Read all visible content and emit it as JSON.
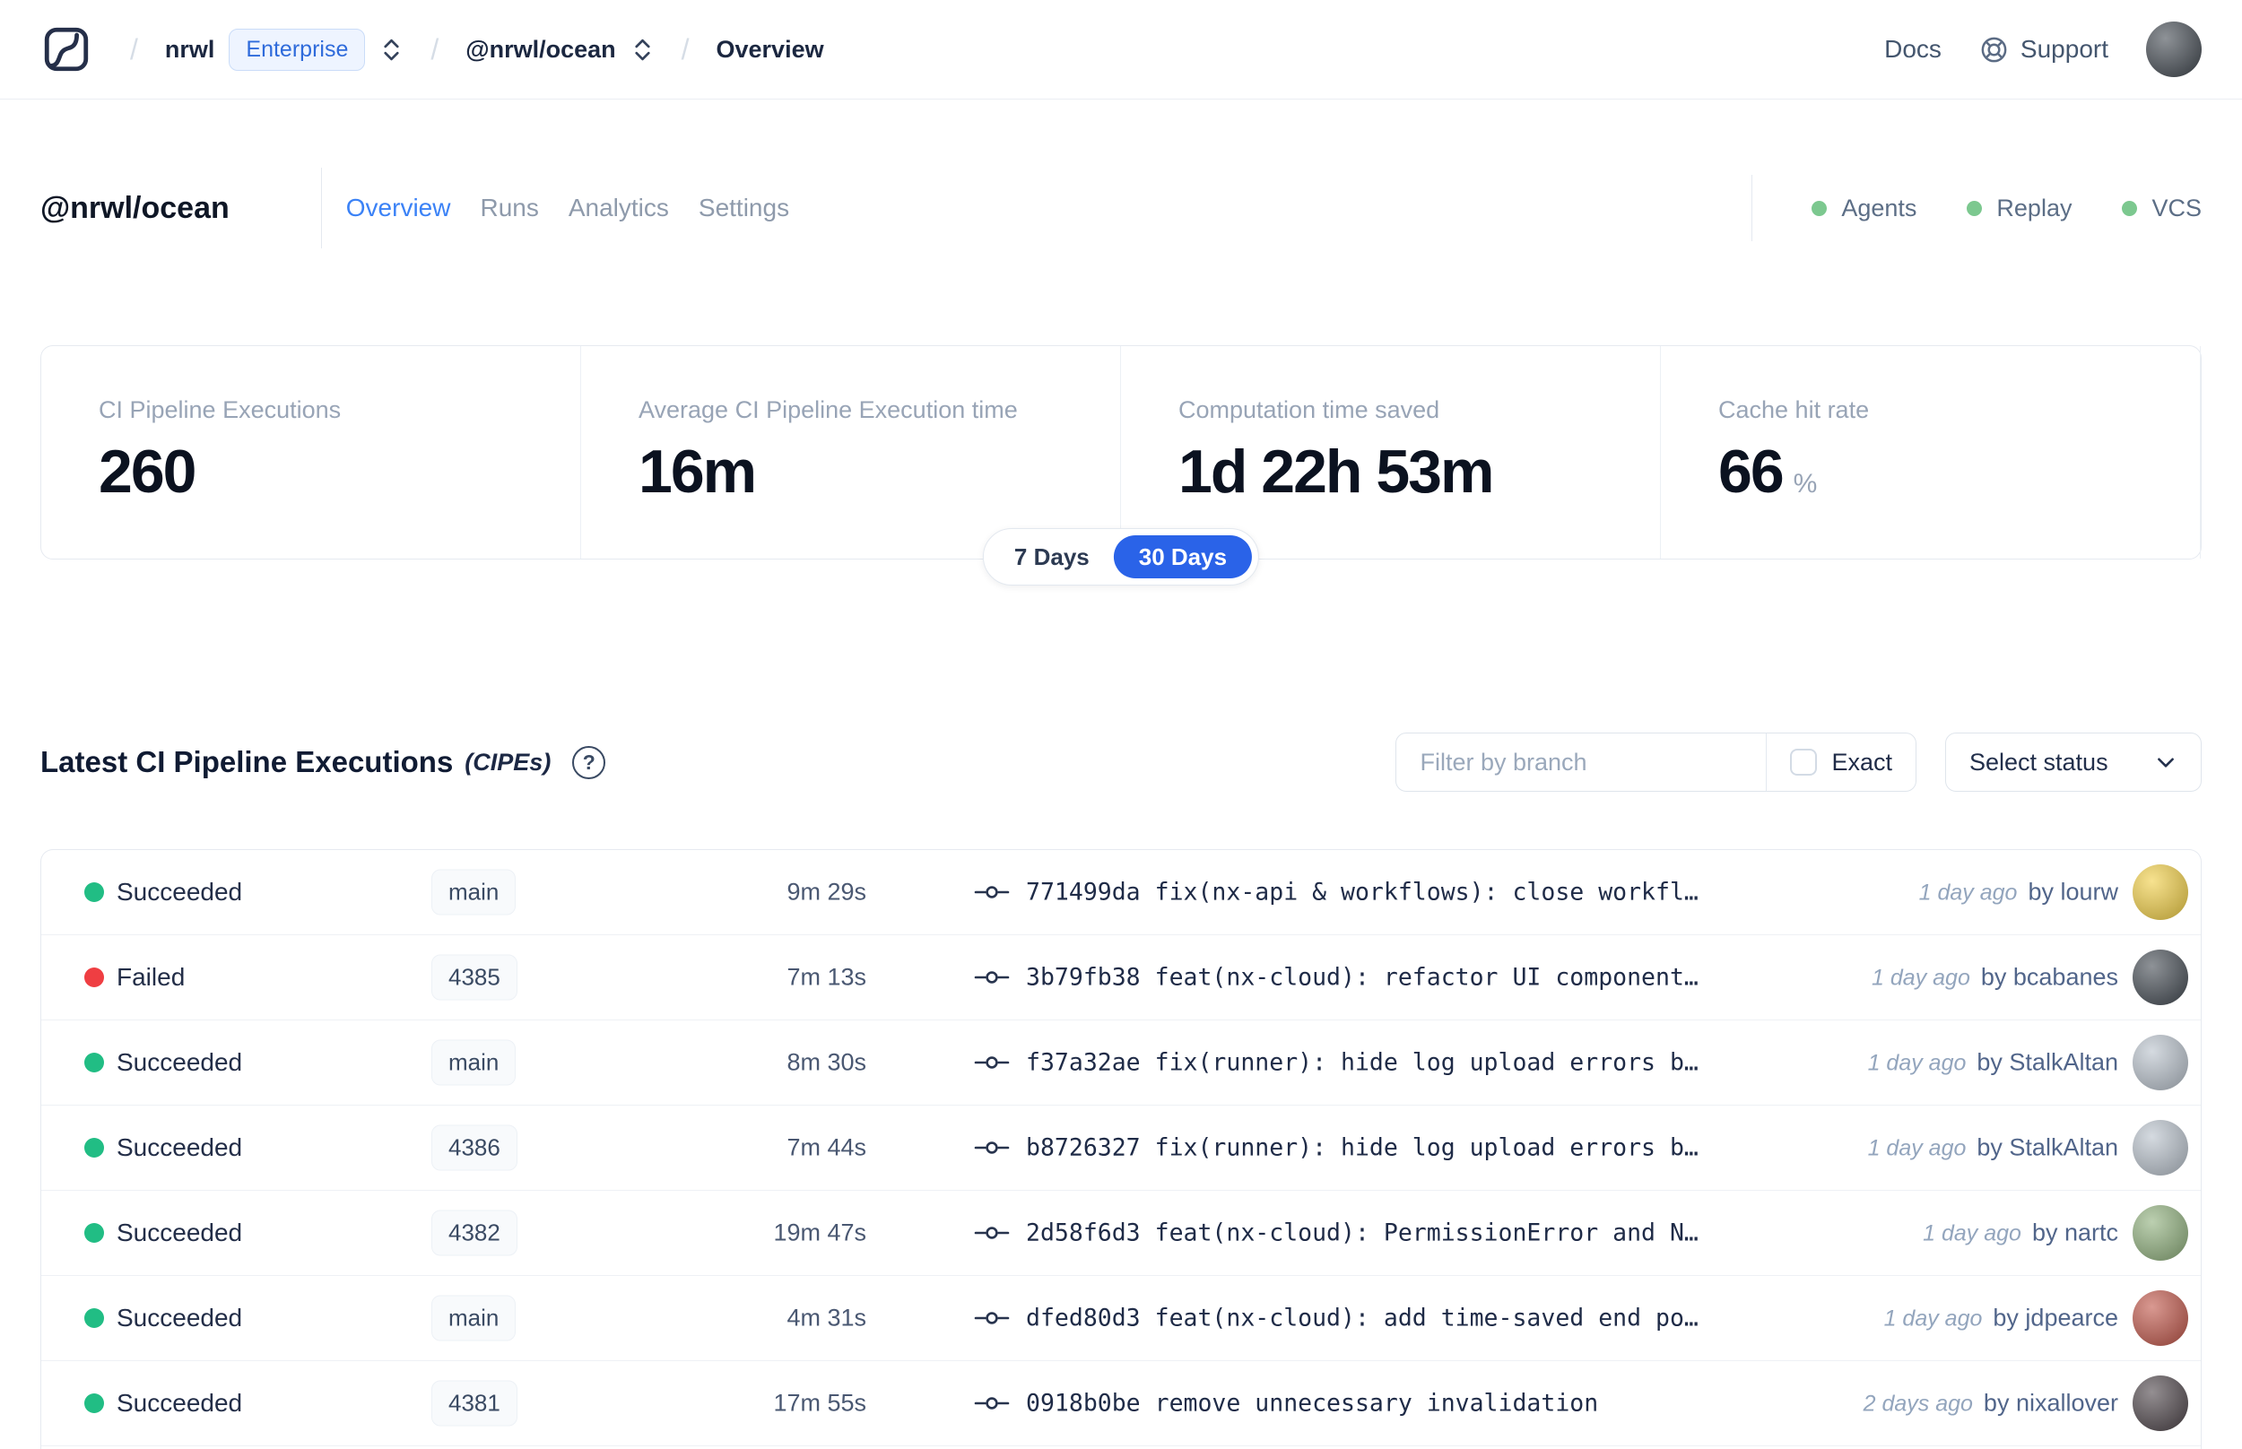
{
  "colors": {
    "success": "#21bd84",
    "failed": "#ef3e42",
    "feature_dot": "#7cc88f",
    "accent": "#2a63e8"
  },
  "nav": {
    "separator": "/",
    "org": "nrwl",
    "org_badge": "Enterprise",
    "workspace": "@nrwl/ocean",
    "page": "Overview",
    "docs": "Docs",
    "support": "Support"
  },
  "header": {
    "workspace": "@nrwl/ocean",
    "tabs": [
      {
        "label": "Overview"
      },
      {
        "label": "Runs"
      },
      {
        "label": "Analytics"
      },
      {
        "label": "Settings"
      }
    ],
    "features": [
      {
        "label": "Agents"
      },
      {
        "label": "Replay"
      },
      {
        "label": "VCS"
      }
    ]
  },
  "stats": {
    "cards": [
      {
        "label": "CI Pipeline Executions",
        "value": "260",
        "unit": ""
      },
      {
        "label": "Average CI Pipeline Execution time",
        "value": "16m",
        "unit": ""
      },
      {
        "label": "Computation time saved",
        "value": "1d 22h 53m",
        "unit": ""
      },
      {
        "label": "Cache hit rate",
        "value": "66",
        "unit": "%"
      }
    ],
    "range": {
      "options": [
        {
          "label": "7 Days"
        },
        {
          "label": "30 Days"
        }
      ],
      "selected": "30 Days"
    }
  },
  "section": {
    "title": "Latest CI Pipeline Executions",
    "subtitle": "(CIPEs)",
    "help_glyph": "?"
  },
  "filters": {
    "branch_placeholder": "Filter by branch",
    "exact": "Exact",
    "status": "Select status"
  },
  "table": {
    "rows": [
      {
        "status": "Succeeded",
        "status_color": "#21bd84",
        "branch": "main",
        "duration": "9m 29s",
        "sha": "771499da",
        "message": "fix(nx-api & workflows): close workfl…",
        "time": "1 day ago",
        "author": "by lourw",
        "avatar_color": "#f2cf45"
      },
      {
        "status": "Failed",
        "status_color": "#ef3e42",
        "branch": "4385",
        "duration": "7m 13s",
        "sha": "3b79fb38",
        "message": "feat(nx-cloud): refactor UI component…",
        "time": "1 day ago",
        "author": "by bcabanes",
        "avatar_color": "#434a52"
      },
      {
        "status": "Succeeded",
        "status_color": "#21bd84",
        "branch": "main",
        "duration": "8m 30s",
        "sha": "f37a32ae",
        "message": "fix(runner): hide log upload errors b…",
        "time": "1 day ago",
        "author": "by StalkAltan",
        "avatar_color": "#b9c2cc"
      },
      {
        "status": "Succeeded",
        "status_color": "#21bd84",
        "branch": "4386",
        "duration": "7m 44s",
        "sha": "b8726327",
        "message": "fix(runner): hide log upload errors b…",
        "time": "1 day ago",
        "author": "by StalkAltan",
        "avatar_color": "#b9c2cc"
      },
      {
        "status": "Succeeded",
        "status_color": "#21bd84",
        "branch": "4382",
        "duration": "19m 47s",
        "sha": "2d58f6d3",
        "message": "feat(nx-cloud): PermissionError and N…",
        "time": "1 day ago",
        "author": "by nartc",
        "avatar_color": "#8fb07c"
      },
      {
        "status": "Succeeded",
        "status_color": "#21bd84",
        "branch": "main",
        "duration": "4m 31s",
        "sha": "dfed80d3",
        "message": "feat(nx-cloud): add time-saved end po…",
        "time": "1 day ago",
        "author": "by jdpearce",
        "avatar_color": "#c05548"
      },
      {
        "status": "Succeeded",
        "status_color": "#21bd84",
        "branch": "4381",
        "duration": "17m 55s",
        "sha": "0918b0be",
        "message": "remove unnecessary invalidation",
        "time": "2 days ago",
        "author": "by nixallover",
        "avatar_color": "#4d4449"
      }
    ]
  }
}
